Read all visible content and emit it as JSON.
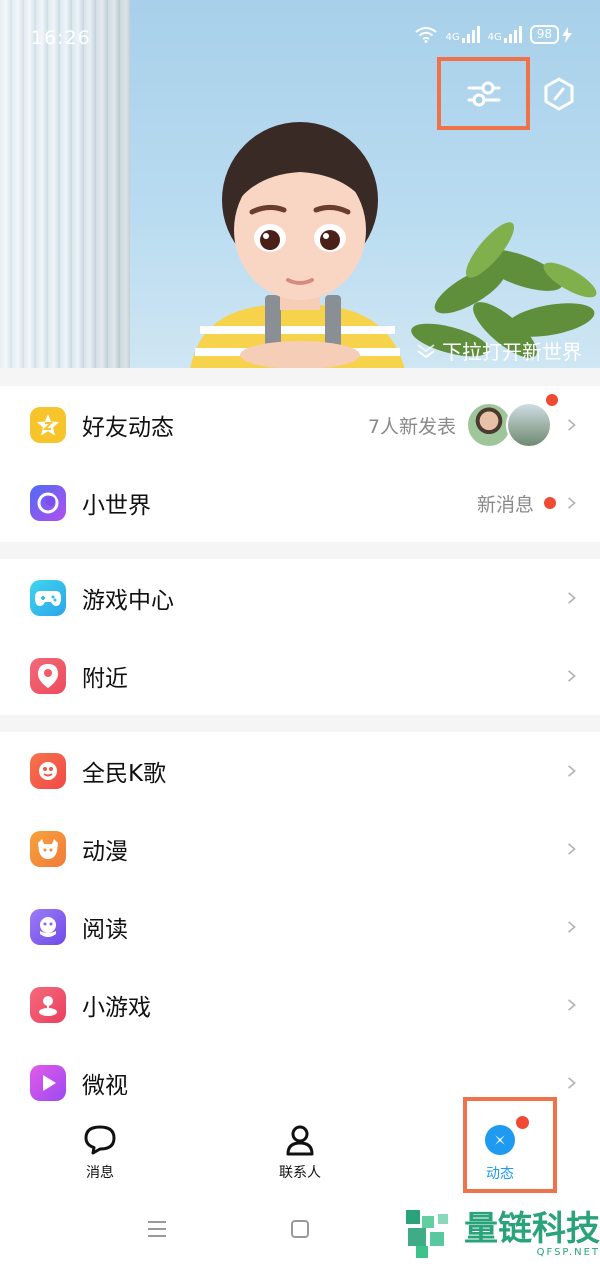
{
  "status_bar": {
    "time": "16:26",
    "signal1_label": "4G",
    "signal2_label": "4G",
    "battery": "98"
  },
  "hero": {
    "pull_hint": "下拉打开新世界"
  },
  "section1": [
    {
      "label": "好友动态",
      "meta": "7人新发表",
      "icon": "friends-feed-star-icon",
      "icon_color": "#f7c52b"
    },
    {
      "label": "小世界",
      "meta": "新消息",
      "icon": "small-world-icon",
      "icon_color": "#7c4df0"
    }
  ],
  "section2": [
    {
      "label": "游戏中心",
      "icon": "gamepad-icon",
      "icon_color": "#2bc3e8"
    },
    {
      "label": "附近",
      "icon": "location-pin-icon",
      "icon_color": "#f05a6a"
    }
  ],
  "section3": [
    {
      "label": "全民K歌",
      "icon": "karaoke-icon",
      "icon_color": "#f2564a"
    },
    {
      "label": "动漫",
      "icon": "anime-face-icon",
      "icon_color": "#f48c3a"
    },
    {
      "label": "阅读",
      "icon": "reading-icon",
      "icon_color": "#8a63f2"
    },
    {
      "label": "小游戏",
      "icon": "mini-game-icon",
      "icon_color": "#f0506a"
    },
    {
      "label": "微视",
      "icon": "weishi-play-icon",
      "icon_color": "#c04ef0"
    }
  ],
  "tabs": [
    {
      "label": "消息",
      "icon": "message-bubble-icon"
    },
    {
      "label": "联系人",
      "icon": "contacts-person-icon"
    },
    {
      "label": "动态",
      "icon": "feed-star-icon"
    }
  ],
  "watermark": {
    "title": "量链科技",
    "sub": "QFSP.NET"
  },
  "colors": {
    "accent_blue": "#1e9bf0",
    "highlight_orange": "#f0724a",
    "notification_red": "#f04b32"
  }
}
